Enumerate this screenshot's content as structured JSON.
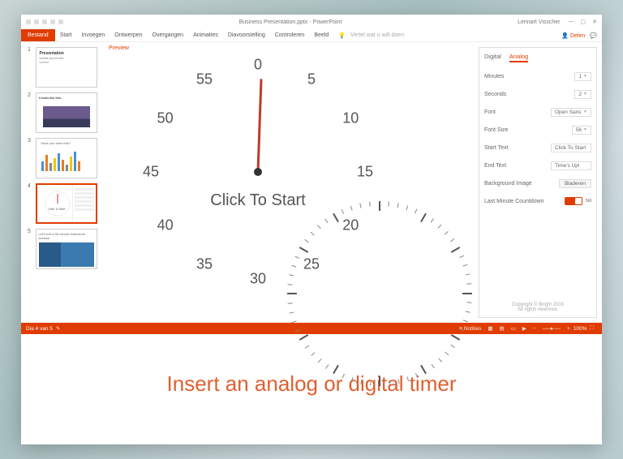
{
  "titlebar": {
    "title": "Business Presentation.pptx - PowerPoint",
    "user": "Lennart Visscher"
  },
  "window_controls": {
    "min": "—",
    "max": "▢",
    "close": "✕"
  },
  "ribbon": {
    "file": "Bestand",
    "tabs": [
      "Start",
      "Invoegen",
      "Ontwerpen",
      "Overgangen",
      "Animaties",
      "Diavoorstelling",
      "Controleren",
      "Beeld"
    ],
    "tell_me": "Vertel wat u wilt doen",
    "share": "Delen"
  },
  "thumbs": {
    "t1": {
      "num": "1",
      "heading": "Presentation",
      "sub1": "subtitle placeholder",
      "sub2": "content"
    },
    "t2": {
      "num": "2",
      "heading": "It looks like this..."
    },
    "t3": {
      "num": "3",
      "heading": "Have you seen this?"
    },
    "t4": {
      "num": "4",
      "cts": "Click To Start"
    },
    "t5": {
      "num": "5",
      "heading": "Let's exit a 30 minute brainstorm session"
    }
  },
  "editor": {
    "preview": "Preview",
    "cts": "Click To Start",
    "dial_numbers": [
      "0",
      "5",
      "10",
      "15",
      "20",
      "25",
      "30",
      "35",
      "40",
      "45",
      "50",
      "55"
    ]
  },
  "panel": {
    "tab_digital": "Digital",
    "tab_analog": "Analog",
    "minutes_lbl": "Minutes",
    "minutes_val": "1",
    "seconds_lbl": "Seconds",
    "seconds_val": "2",
    "font_lbl": "Font",
    "font_val": "Open Sans",
    "fontsize_lbl": "Font Size",
    "fontsize_val": "56",
    "start_lbl": "Start Text",
    "start_val": "Click To Start",
    "end_lbl": "End Text",
    "end_val": "Time's Up!",
    "bg_lbl": "Background Image",
    "bg_btn": "Bladeren",
    "lmc_lbl": "Last Minute Countdown",
    "lmc_small": "Stil",
    "copyright": "Copyright © Bright 2016",
    "rights": "All rights reserved."
  },
  "status": {
    "left": "Dia 4 van 5",
    "notes": "Notities",
    "zoom": "100%"
  },
  "caption": "Insert an analog or digital timer"
}
